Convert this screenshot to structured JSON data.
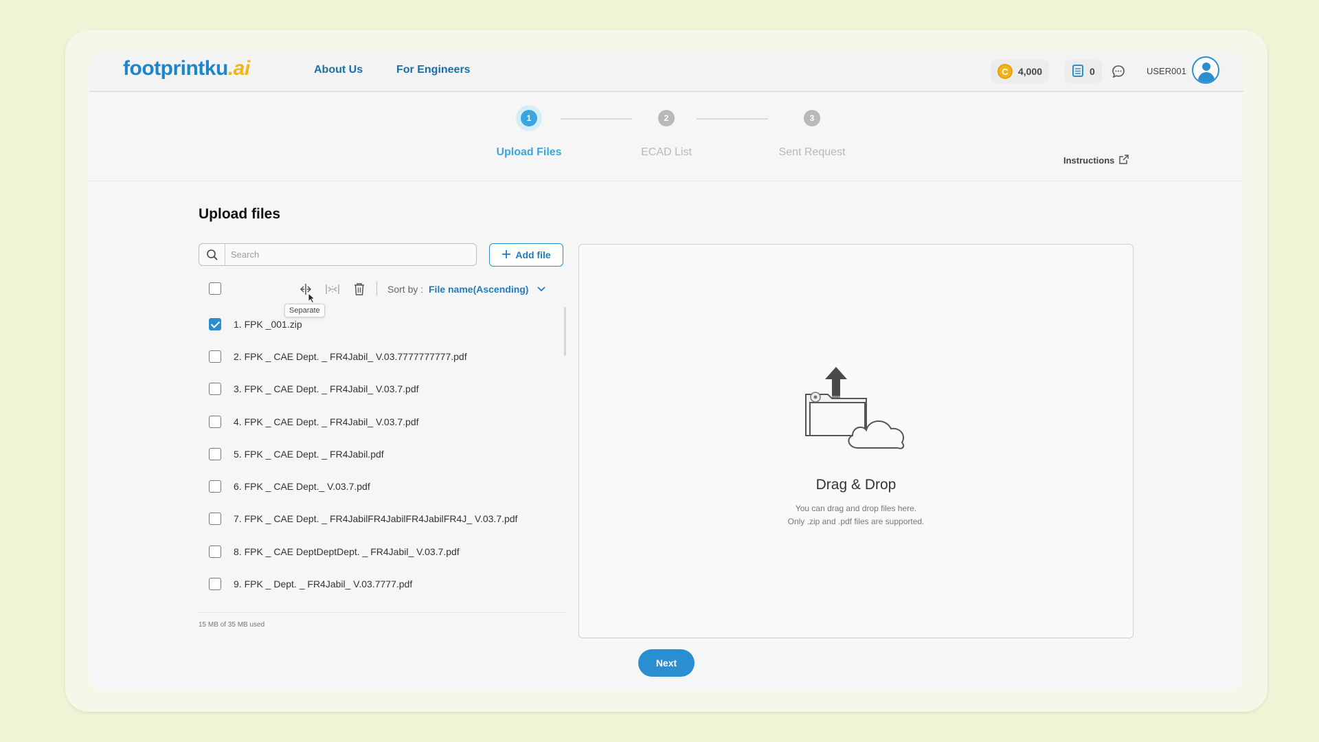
{
  "header": {
    "logo_main": "footprintku",
    "logo_suffix": ".ai",
    "nav": [
      {
        "label": "About Us"
      },
      {
        "label": "For Engineers"
      }
    ],
    "coins": "4,000",
    "coin_symbol": "C",
    "cart_count": "0",
    "username": "USER001"
  },
  "stepper": {
    "steps": [
      {
        "number": "1",
        "label": "Upload Files",
        "active": true
      },
      {
        "number": "2",
        "label": "ECAD List",
        "active": false
      },
      {
        "number": "3",
        "label": "Sent Request",
        "active": false
      }
    ],
    "instructions_label": "Instructions"
  },
  "main": {
    "title": "Upload files",
    "search_placeholder": "Search",
    "add_file_label": "Add file",
    "sort_label": "Sort by :",
    "sort_value": "File name(Ascending)",
    "tooltip": "Separate",
    "files": [
      {
        "name": "1. FPK _001.zip",
        "checked": true
      },
      {
        "name": "2. FPK _ CAE Dept. _ FR4Jabil_ V.03.7777777777.pdf",
        "checked": false
      },
      {
        "name": "3. FPK _ CAE Dept. _ FR4Jabil_ V.03.7.pdf",
        "checked": false
      },
      {
        "name": "4. FPK _ CAE Dept. _ FR4Jabil_ V.03.7.pdf",
        "checked": false
      },
      {
        "name": "5. FPK _ CAE Dept. _ FR4Jabil.pdf",
        "checked": false
      },
      {
        "name": "6. FPK _ CAE Dept._ V.03.7.pdf",
        "checked": false
      },
      {
        "name": "7. FPK _ CAE Dept. _ FR4JabilFR4JabilFR4JabilFR4J_ V.03.7.pdf",
        "checked": false
      },
      {
        "name": "8. FPK _ CAE DeptDeptDept. _ FR4Jabil_ V.03.7.pdf",
        "checked": false
      },
      {
        "name": "9. FPK _ Dept. _ FR4Jabil_ V.03.7777.pdf",
        "checked": false
      }
    ],
    "storage_text": "15 MB of 35 MB used"
  },
  "dropzone": {
    "title": "Drag & Drop",
    "line1": "You can drag and drop files here.",
    "line2": "Only .zip and .pdf files are supported."
  },
  "next_label": "Next",
  "colors": {
    "accent": "#2a8fd0",
    "brand_yellow": "#f2b416",
    "background": "#eef5d6"
  }
}
